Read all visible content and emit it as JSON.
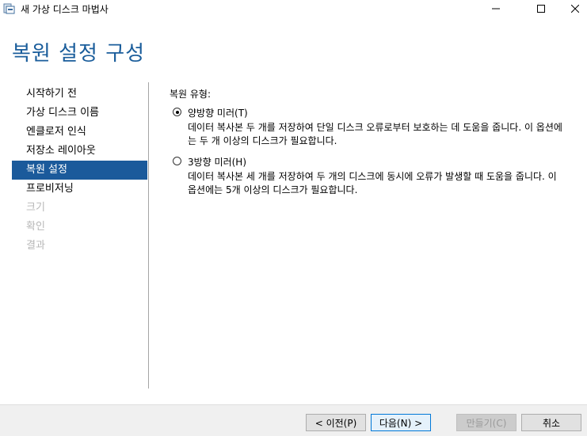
{
  "window": {
    "title": "새 가상 디스크 마법사",
    "icon": "disk-wizard-icon"
  },
  "header": {
    "title": "복원 설정 구성"
  },
  "sidebar": {
    "items": [
      {
        "label": "시작하기 전",
        "state": "normal"
      },
      {
        "label": "가상 디스크 이름",
        "state": "normal"
      },
      {
        "label": "엔클로저 인식",
        "state": "normal"
      },
      {
        "label": "저장소 레이아웃",
        "state": "normal"
      },
      {
        "label": "복원 설정",
        "state": "active"
      },
      {
        "label": "프로비저닝",
        "state": "normal"
      },
      {
        "label": "크기",
        "state": "disabled"
      },
      {
        "label": "확인",
        "state": "disabled"
      },
      {
        "label": "결과",
        "state": "disabled"
      }
    ]
  },
  "main": {
    "section_label": "복원 유형:",
    "options": [
      {
        "label": "양방향 미러(T)",
        "selected": true,
        "description": "데이터 복사본 두 개를 저장하여 단일 디스크 오류로부터 보호하는 데 도움을 줍니다. 이 옵션에는 두 개 이상의 디스크가 필요합니다."
      },
      {
        "label": "3방향 미러(H)",
        "selected": false,
        "description": "데이터 복사본 세 개를 저장하여 두 개의 디스크에 동시에 오류가 발생할 때 도움을 줍니다. 이 옵션에는 5개 이상의 디스크가 필요합니다."
      }
    ]
  },
  "footer": {
    "prev_label": "< 이전(P)",
    "next_label": "다음(N) >",
    "finish_label": "만들기(C)",
    "cancel_label": "취소"
  },
  "colors": {
    "accent": "#1a5d9b",
    "active_nav": "#1b5a9b",
    "disabled_text": "#b7b7b7"
  }
}
